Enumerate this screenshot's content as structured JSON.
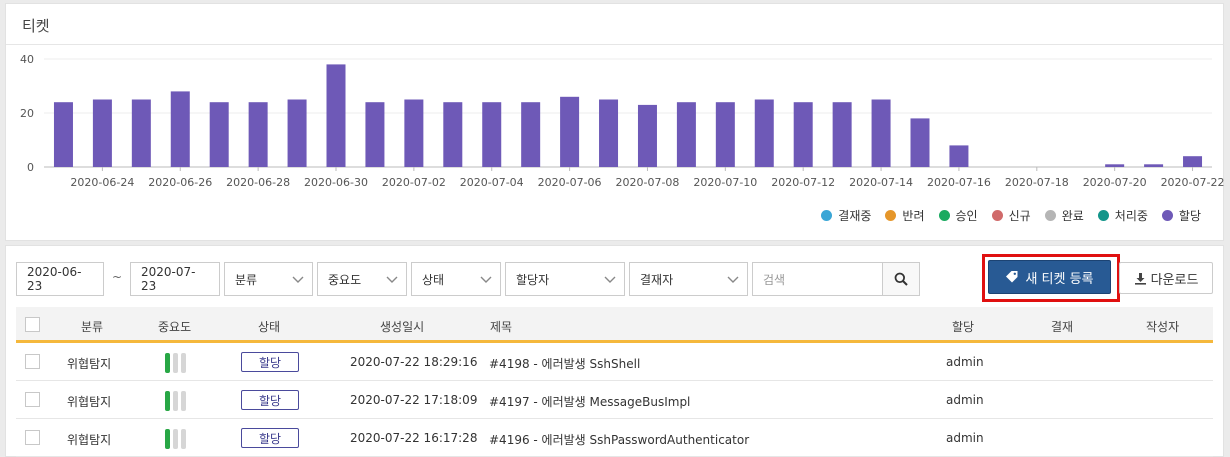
{
  "panel": {
    "title": "티켓"
  },
  "chart_data": {
    "type": "bar",
    "title": "",
    "xlabel": "",
    "ylabel": "",
    "ylim": [
      0,
      40
    ],
    "yticks": [
      0,
      20,
      40
    ],
    "grid": "horizontal",
    "legend_position": "bottom-right",
    "categories": [
      "2020-06-23",
      "2020-06-24",
      "2020-06-25",
      "2020-06-26",
      "2020-06-27",
      "2020-06-28",
      "2020-06-29",
      "2020-06-30",
      "2020-07-01",
      "2020-07-02",
      "2020-07-03",
      "2020-07-04",
      "2020-07-05",
      "2020-07-06",
      "2020-07-07",
      "2020-07-08",
      "2020-07-09",
      "2020-07-10",
      "2020-07-11",
      "2020-07-12",
      "2020-07-13",
      "2020-07-14",
      "2020-07-15",
      "2020-07-16",
      "2020-07-17",
      "2020-07-18",
      "2020-07-19",
      "2020-07-20",
      "2020-07-21",
      "2020-07-22"
    ],
    "tick_labels": [
      "2020-06-24",
      "2020-06-26",
      "2020-06-28",
      "2020-06-30",
      "2020-07-02",
      "2020-07-04",
      "2020-07-06",
      "2020-07-08",
      "2020-07-10",
      "2020-07-12",
      "2020-07-14",
      "2020-07-16",
      "2020-07-18",
      "2020-07-20",
      "2020-07-22"
    ],
    "series": [
      {
        "name": "결재중",
        "color": "#3aa6d6",
        "values": [
          0,
          0,
          0,
          0,
          0,
          0,
          0,
          0,
          0,
          0,
          0,
          0,
          0,
          0,
          0,
          0,
          0,
          0,
          0,
          0,
          0,
          0,
          0,
          0,
          0,
          0,
          0,
          0,
          0,
          0
        ]
      },
      {
        "name": "반려",
        "color": "#e5962a",
        "values": [
          0,
          0,
          0,
          0,
          0,
          0,
          0,
          0,
          0,
          0,
          0,
          0,
          0,
          0,
          0,
          0,
          0,
          0,
          0,
          0,
          0,
          0,
          0,
          0,
          0,
          0,
          0,
          0,
          0,
          0
        ]
      },
      {
        "name": "승인",
        "color": "#1aaa60",
        "values": [
          0,
          0,
          0,
          0,
          0,
          0,
          0,
          0,
          0,
          0,
          0,
          0,
          0,
          0,
          0,
          0,
          0,
          0,
          0,
          0,
          0,
          0,
          0,
          0,
          0,
          0,
          0,
          0,
          0,
          0
        ]
      },
      {
        "name": "신규",
        "color": "#d06a6a",
        "values": [
          0,
          0,
          0,
          0,
          0,
          0,
          0,
          0,
          0,
          0,
          0,
          0,
          0,
          0,
          0,
          0,
          0,
          0,
          0,
          0,
          0,
          0,
          0,
          0,
          0,
          0,
          0,
          0,
          0,
          0
        ]
      },
      {
        "name": "완료",
        "color": "#b5b5b5",
        "values": [
          0,
          0,
          0,
          0,
          0,
          0,
          0,
          0,
          0,
          0,
          0,
          0,
          0,
          0,
          0,
          0,
          0,
          0,
          0,
          0,
          0,
          0,
          0,
          0,
          0,
          0,
          0,
          0,
          0,
          0
        ]
      },
      {
        "name": "처리중",
        "color": "#13958a",
        "values": [
          0,
          0,
          0,
          0,
          0,
          0,
          0,
          0,
          0,
          0,
          0,
          0,
          0,
          0,
          0,
          0,
          0,
          0,
          0,
          0,
          0,
          0,
          0,
          0,
          0,
          0,
          0,
          0,
          0,
          0
        ]
      },
      {
        "name": "할당",
        "color": "#6e59b7",
        "values": [
          24,
          25,
          25,
          28,
          24,
          24,
          25,
          38,
          24,
          25,
          24,
          24,
          24,
          26,
          25,
          23,
          24,
          24,
          25,
          24,
          24,
          25,
          18,
          8,
          0,
          0,
          0,
          1,
          1,
          4
        ]
      }
    ]
  },
  "filters": {
    "date_from": "2020-06-23",
    "tilde": "~",
    "date_to": "2020-07-23",
    "category": "분류",
    "importance": "중요도",
    "status": "상태",
    "assignee": "할당자",
    "approver": "결재자",
    "search_placeholder": "검색"
  },
  "actions": {
    "new_ticket": "새 티켓 등록",
    "download": "다운로드"
  },
  "table": {
    "headers": {
      "category": "분류",
      "importance": "중요도",
      "status": "상태",
      "created": "생성일시",
      "title": "제목",
      "assignee": "할당",
      "approval": "결재",
      "author": "작성자"
    },
    "rows": [
      {
        "category": "위협탐지",
        "importance": 1,
        "status": "할당",
        "created": "2020-07-22 18:29:16",
        "title": "#4198 - 에러발생 SshShell",
        "assignee": "admin"
      },
      {
        "category": "위협탐지",
        "importance": 1,
        "status": "할당",
        "created": "2020-07-22 17:18:09",
        "title": "#4197 - 에러발생 MessageBusImpl",
        "assignee": "admin"
      },
      {
        "category": "위협탐지",
        "importance": 1,
        "status": "할당",
        "created": "2020-07-22 16:17:28",
        "title": "#4196 - 에러발생 SshPasswordAuthenticator",
        "assignee": "admin"
      }
    ]
  }
}
